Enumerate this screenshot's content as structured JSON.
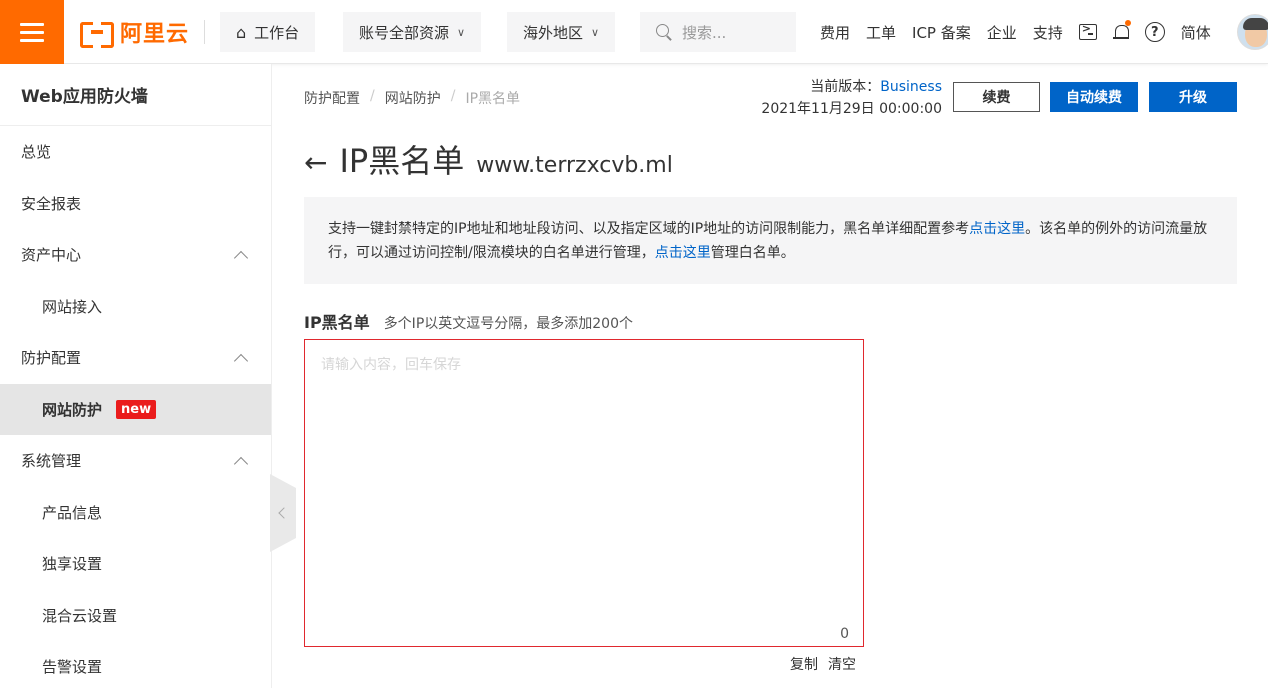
{
  "topbar": {
    "logo_text": "阿里云",
    "workbench": "工作台",
    "resource_scope": "账号全部资源",
    "region": "海外地区",
    "search_placeholder": "搜索...",
    "links": {
      "fees": "费用",
      "tickets": "工单",
      "icp": "ICP 备案",
      "enterprise": "企业",
      "support": "支持",
      "language": "简体"
    }
  },
  "sidebar": {
    "title": "Web应用防火墙",
    "items": [
      {
        "label": "总览",
        "level": 1
      },
      {
        "label": "安全报表",
        "level": 1
      },
      {
        "label": "资产中心",
        "level": 1,
        "expandable": true
      },
      {
        "label": "网站接入",
        "level": 2
      },
      {
        "label": "防护配置",
        "level": 1,
        "expandable": true
      },
      {
        "label": "网站防护",
        "level": 2,
        "active": true,
        "badge": "new"
      },
      {
        "label": "系统管理",
        "level": 1,
        "expandable": true
      },
      {
        "label": "产品信息",
        "level": 2
      },
      {
        "label": "独享设置",
        "level": 2
      },
      {
        "label": "混合云设置",
        "level": 2
      },
      {
        "label": "告警设置",
        "level": 2
      }
    ]
  },
  "breadcrumb": [
    "防护配置",
    "网站防护",
    "IP黑名单"
  ],
  "version": {
    "label": "当前版本：",
    "edition": "Business",
    "expiry": "2021年11月29日 00:00:00"
  },
  "buttons": {
    "renew": "续费",
    "auto_renew": "自动续费",
    "upgrade": "升级"
  },
  "page": {
    "title": "IP黑名单",
    "domain": "www.terrzxcvb.ml"
  },
  "notice": {
    "part1": "支持一键封禁特定的IP地址和地址段访问、以及指定区域的IP地址的访问限制能力，黑名单详细配置参考",
    "link1": "点击这里",
    "part2": "。该名单的例外的访问流量放行，可以通过访问控制/限流模块的白名单进行管理，",
    "link2": "点击这里",
    "part3": "管理白名单。"
  },
  "field": {
    "label": "IP黑名单",
    "hint": "多个IP以英文逗号分隔，最多添加200个",
    "placeholder": "请输入内容，回车保存",
    "value": "",
    "count": "0"
  },
  "textarea_actions": {
    "copy": "复制",
    "clear": "清空"
  },
  "colors": {
    "brand_orange": "#ff6a00",
    "primary_blue": "#0064c8",
    "error_red": "#e0282e",
    "badge_red": "#ea1c1c"
  }
}
